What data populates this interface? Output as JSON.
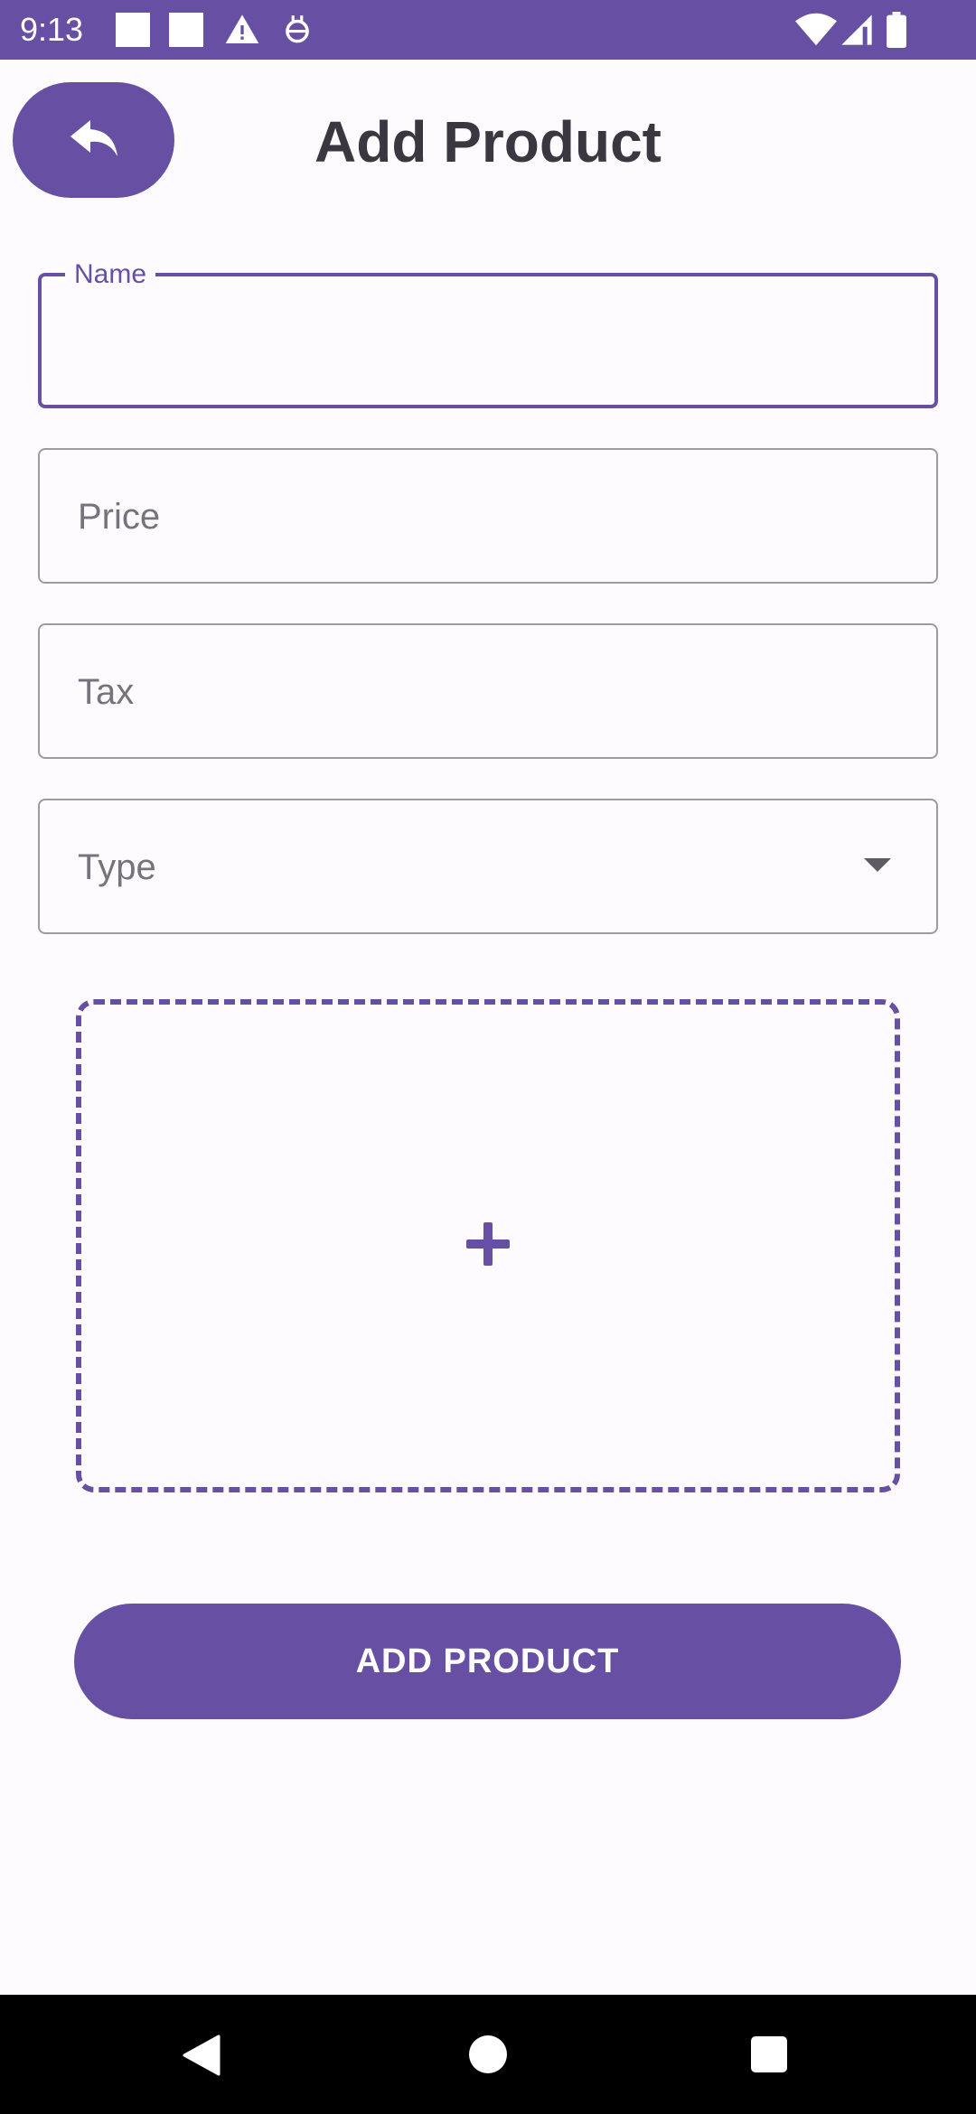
{
  "status_bar": {
    "time": "9:13",
    "left_icons": [
      "square-notification-icon",
      "square-notification-icon",
      "warning-icon",
      "robot-icon"
    ],
    "right_icons": [
      "wifi-icon",
      "signal-icon",
      "battery-icon"
    ]
  },
  "header": {
    "back_icon": "reply-arrow-icon",
    "title": "Add Product"
  },
  "form": {
    "name_label": "Name",
    "name_value": "",
    "price_placeholder": "Price",
    "tax_placeholder": "Tax",
    "type_placeholder": "Type",
    "image_picker_icon": "plus-icon",
    "submit_label": "ADD PRODUCT"
  },
  "nav_bar": {
    "icons": [
      "back-triangle-icon",
      "home-circle-icon",
      "recents-square-icon"
    ]
  },
  "colors": {
    "primary": "#6750a4",
    "background": "#fefbff",
    "outline": "#9e9aa3",
    "title": "#3a3740",
    "placeholder": "#77737d"
  }
}
